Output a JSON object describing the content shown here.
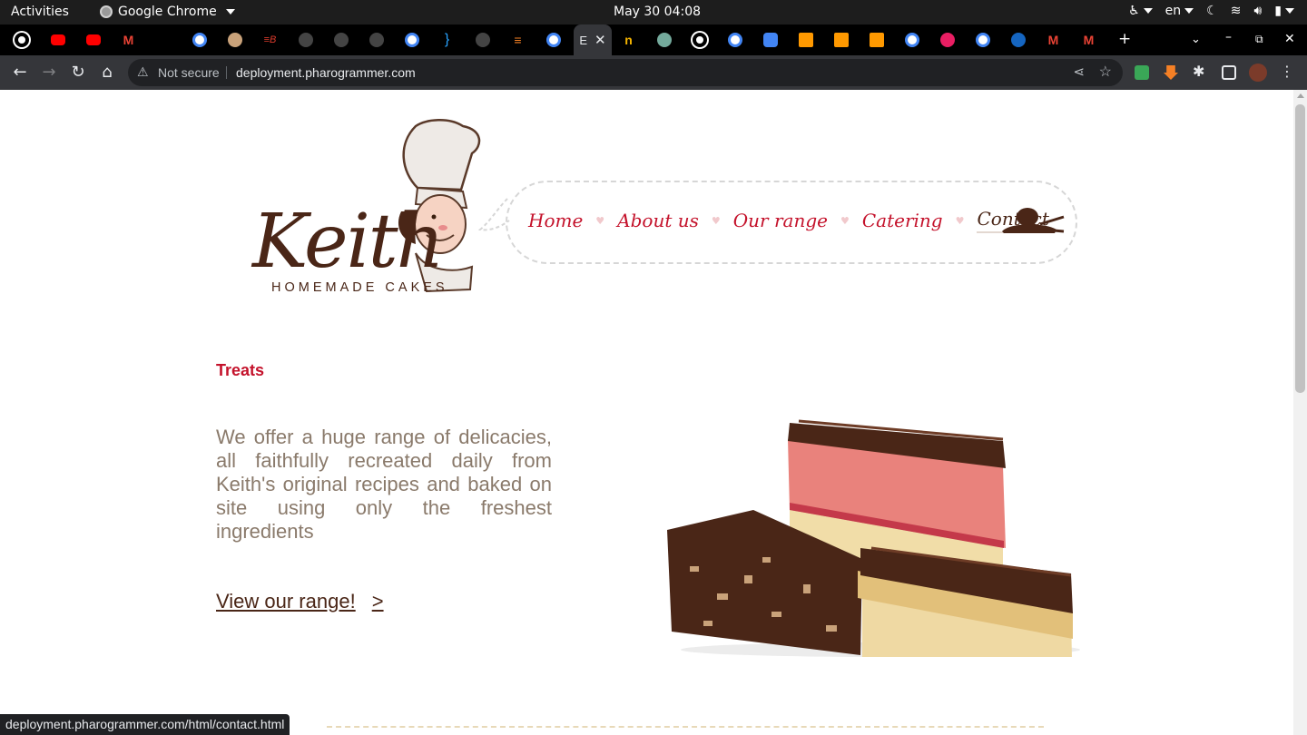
{
  "system": {
    "activities": "Activities",
    "app_name": "Google Chrome",
    "clock": "May 30  04:08",
    "language": "en"
  },
  "browser": {
    "security_label": "Not secure",
    "url": "deployment.pharogrammer.com",
    "status_url": "deployment.pharogrammer.com/html/contact.html",
    "active_tab_label": "E"
  },
  "site": {
    "logo_name": "Keith",
    "logo_tagline": "HOMEMADE CAKES",
    "nav": [
      {
        "label": "Home"
      },
      {
        "label": "About us"
      },
      {
        "label": "Our range"
      },
      {
        "label": "Catering"
      },
      {
        "label": "Contact"
      }
    ],
    "section_title": "Treats",
    "blurb": "We offer a huge range of delicacies, all faithfully recreated daily from Keith's original recipes and baked on site using only the freshest ingredients",
    "cta_label": "View our range!",
    "cta_arrow": ">"
  },
  "colors": {
    "brand_red": "#c4122b",
    "brand_brown": "#4a2617",
    "body_text": "#8a7a6b"
  }
}
